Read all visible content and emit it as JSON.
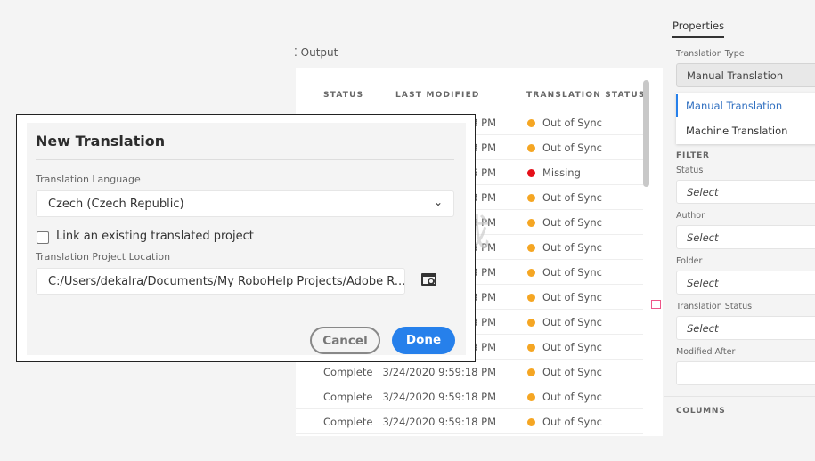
{
  "panel": {
    "output_label": "Output"
  },
  "table": {
    "headers": {
      "status": "STATUS",
      "last_modified": "LAST MODIFIED",
      "translation_status": "TRANSLATION STATUS"
    },
    "rows": [
      {
        "status": "",
        "modified": "8 PM",
        "translation": "Out of Sync",
        "color": "#f5a623"
      },
      {
        "status": "",
        "modified": "8 PM",
        "translation": "Out of Sync",
        "color": "#f5a623"
      },
      {
        "status": "",
        "modified": "6 PM",
        "translation": "Missing",
        "color": "#e5101a"
      },
      {
        "status": "",
        "modified": "8 PM",
        "translation": "Out of Sync",
        "color": "#f5a623"
      },
      {
        "status": "",
        "modified": "8 PM",
        "translation": "Out of Sync",
        "color": "#f5a623"
      },
      {
        "status": "",
        "modified": "8 PM",
        "translation": "Out of Sync",
        "color": "#f5a623"
      },
      {
        "status": "",
        "modified": "8 PM",
        "translation": "Out of Sync",
        "color": "#f5a623"
      },
      {
        "status": "",
        "modified": "8 PM",
        "translation": "Out of Sync",
        "color": "#f5a623"
      },
      {
        "status": "",
        "modified": "8 PM",
        "translation": "Out of Sync",
        "color": "#f5a623"
      },
      {
        "status": "",
        "modified": "8 PM",
        "translation": "Out of Sync",
        "color": "#f5a623"
      },
      {
        "status": "Complete",
        "modified": "3/24/2020 9:59:18 PM",
        "translation": "Out of Sync",
        "color": "#f5a623"
      },
      {
        "status": "Complete",
        "modified": "3/24/2020 9:59:18 PM",
        "translation": "Out of Sync",
        "color": "#f5a623"
      },
      {
        "status": "Complete",
        "modified": "3/24/2020 9:59:18 PM",
        "translation": "Out of Sync",
        "color": "#f5a623"
      }
    ]
  },
  "properties": {
    "tab": "Properties",
    "translation_type_label": "Translation Type",
    "translation_type_value": "Manual Translation",
    "options": [
      "Manual Translation",
      "Machine Translation"
    ],
    "filter_heading": "FILTER",
    "filters": [
      {
        "label": "Status",
        "value": "Select"
      },
      {
        "label": "Author",
        "value": "Select"
      },
      {
        "label": "Folder",
        "value": "Select"
      },
      {
        "label": "Translation Status",
        "value": "Select"
      },
      {
        "label": "Modified After",
        "value": ""
      }
    ],
    "columns_heading": "COLUMNS"
  },
  "dialog": {
    "title": "New Translation",
    "language_label": "Translation Language",
    "language_value": "Czech (Czech Republic)",
    "link_checkbox_label": "Link an existing translated project",
    "link_checked": false,
    "location_label": "Translation Project Location",
    "location_value": "C:/Users/dekalra/Documents/My RoboHelp Projects/Adobe R...",
    "cancel": "Cancel",
    "done": "Done",
    "accent": "#2680eb"
  },
  "watermark": {
    "text": "安下载 anxz.com"
  }
}
